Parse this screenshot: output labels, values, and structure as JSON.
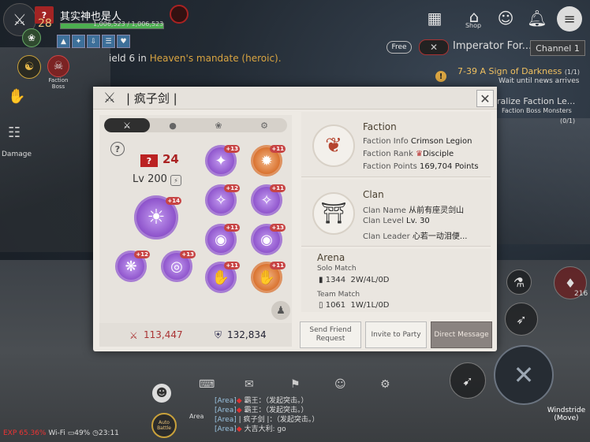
{
  "hud": {
    "player_name": "其实神也是人",
    "level": "28",
    "hp_text": "1,006,523 / 1,006,523",
    "hp_fraction": 1.0,
    "faction_boss_label": "Faction Boss",
    "shop_label": "Shop",
    "free_label": "Free",
    "imperator_label": "Imperator For...",
    "channel_label": "Channel 1",
    "notice_prefix": "ield 6 in ",
    "notice_highlight": "Heaven's mandate (heroic).",
    "damage_label": "Damage"
  },
  "quests": {
    "q1_title": "7-39 A Sign of Darkness",
    "q1_count": "(1/1)",
    "q1_sub": "Wait until news arrives",
    "q2_title": "ralize Faction Le...",
    "q2_sub": "Faction Boss Monsters",
    "q2_count": "(0/1)"
  },
  "modal": {
    "title": "| 疯子剑 |",
    "tabs": [
      "⚔",
      "●",
      "❀",
      "⚙"
    ],
    "power_badge": "?",
    "power": "24",
    "level_text": "Lv 200",
    "attack": "113,447",
    "defense": "132,834",
    "gear": [
      {
        "enh": "+13",
        "icon": "✦",
        "rarity": "purple"
      },
      {
        "enh": "+11",
        "icon": "✹",
        "rarity": "orange"
      },
      {
        "enh": "+12",
        "icon": "✧",
        "rarity": "purple"
      },
      {
        "enh": "+11",
        "icon": "✧",
        "rarity": "purple"
      },
      {
        "enh": "+14",
        "icon": "☀",
        "rarity": "purple"
      },
      {
        "enh": "+11",
        "icon": "◉",
        "rarity": "purple"
      },
      {
        "enh": "+13",
        "icon": "◉",
        "rarity": "purple"
      },
      {
        "enh": "+12",
        "icon": "❋",
        "rarity": "purple"
      },
      {
        "enh": "+13",
        "icon": "◎",
        "rarity": "purple"
      },
      {
        "enh": "+11",
        "icon": "✋",
        "rarity": "purple"
      },
      {
        "enh": "+11",
        "icon": "✋",
        "rarity": "orange"
      }
    ],
    "faction": {
      "title": "Faction",
      "info_label": "Faction Info",
      "info_value": "Crimson Legion",
      "rank_label": "Faction Rank",
      "rank_value": "Disciple",
      "points_label": "Faction Points",
      "points_value": "169,704 Points"
    },
    "clan": {
      "title": "Clan",
      "name_label": "Clan Name",
      "name_value": "从前有座灵剑山",
      "level_label": "Clan Level",
      "level_value": "Lv. 30",
      "leader_label": "Clan Leader",
      "leader_value": "心若一动泪便..."
    },
    "arena": {
      "title": "Arena",
      "solo_label": "Solo Match",
      "solo_score": "1344",
      "solo_record": "2W/4L/0D",
      "team_label": "Team Match",
      "team_score": "1061",
      "team_record": "1W/1L/0D"
    },
    "buttons": {
      "friend": "Send Friend Request",
      "party": "Invite to Party",
      "dm": "Direct Message"
    }
  },
  "chat": {
    "lines": [
      {
        "tag": "[Area]",
        "text": "霸王：（发起突击。）"
      },
      {
        "tag": "[Area]",
        "text": "霸王：（发起突击。）"
      },
      {
        "tag": "[Area]",
        "text": "| 疯子剑 |：（发起突击。）"
      },
      {
        "tag": "[Area]",
        "text": "大吉大利: go"
      }
    ],
    "area_label": "Area",
    "auto_battle": "Auto Battle"
  },
  "status": {
    "exp_label": "EXP 65.36%",
    "wifi": "Wi-Fi",
    "battery": "49%",
    "time": "23:11"
  },
  "controls": {
    "windstride": "Windstride (Move)",
    "count_216": "216"
  },
  "colors": {
    "accent_red": "#a32424",
    "gold": "#d9a441",
    "modal_bg": "#eeeae4"
  }
}
